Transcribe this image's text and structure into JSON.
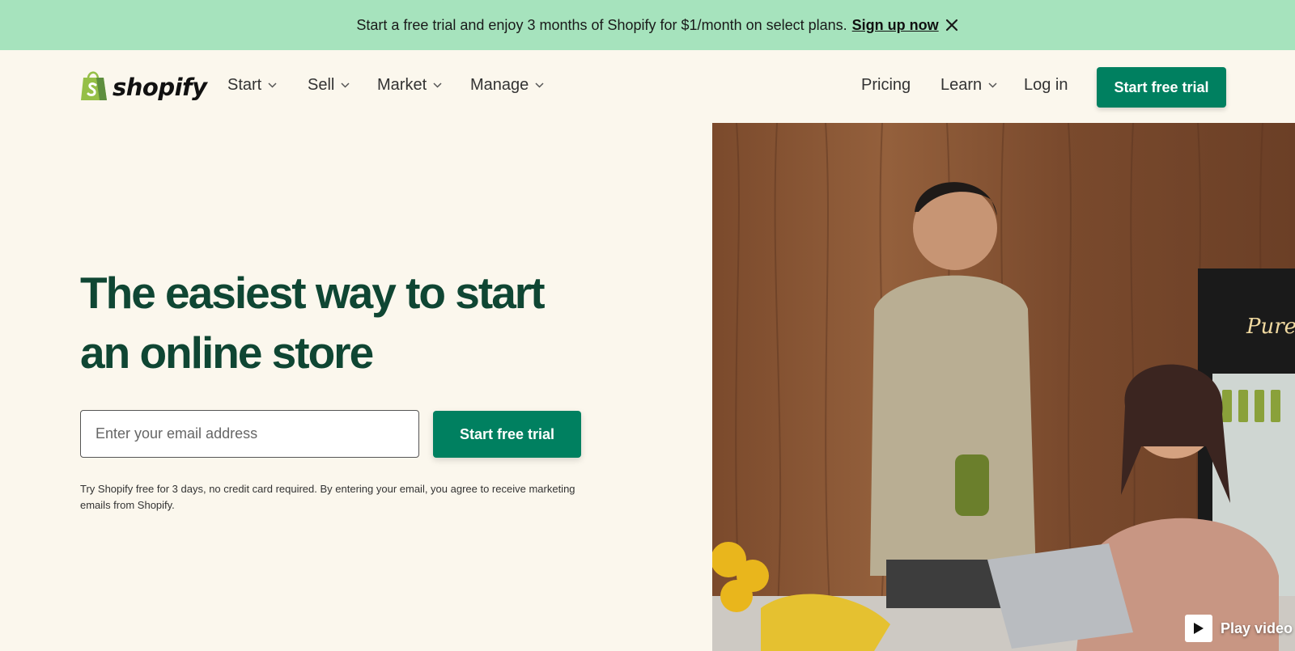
{
  "promo": {
    "text": "Start a free trial and enjoy 3 months of Shopify for $1/month on select plans.",
    "link": "Sign up now",
    "close_icon": "close-icon"
  },
  "nav": {
    "logo_text": "shopify",
    "logo_icon": "shopping-bag-icon",
    "menu": [
      {
        "label": "Start",
        "has_dropdown": true
      },
      {
        "label": "Sell",
        "has_dropdown": true
      },
      {
        "label": "Market",
        "has_dropdown": true
      },
      {
        "label": "Manage",
        "has_dropdown": true
      }
    ],
    "right": {
      "pricing": "Pricing",
      "learn": "Learn",
      "login": "Log in",
      "cta": "Start free trial"
    }
  },
  "hero": {
    "title": "The easiest way to start an online store",
    "email_placeholder": "Enter your email address",
    "cta": "Start free trial",
    "disclaimer": "Try Shopify free for 3 days, no credit card required. By entering your email, you agree to receive marketing emails from Shopify.",
    "image_sign_text": "Pure",
    "play_video": "Play video"
  },
  "colors": {
    "promo_bg": "#a6e3bd",
    "page_bg": "#fbf7ed",
    "brand_green": "#008060",
    "title_green": "#0f4633",
    "logo_green": "#95bf47"
  }
}
